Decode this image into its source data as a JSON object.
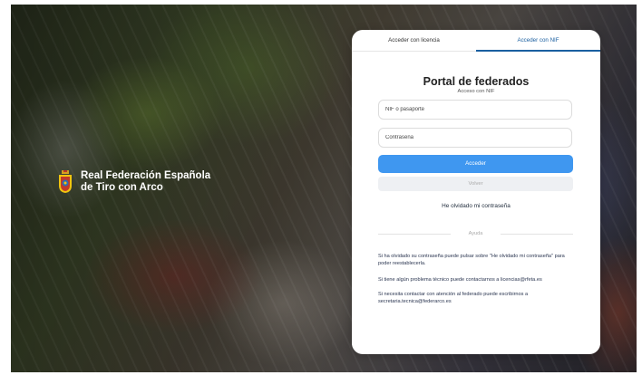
{
  "brand": {
    "name_line1": "Real Federación Española",
    "name_line2": "de Tiro con Arco"
  },
  "tabs": [
    {
      "label": "Acceder con licencia",
      "active": false
    },
    {
      "label": "Acceder con NIF",
      "active": true
    }
  ],
  "login": {
    "title": "Portal de federados",
    "subtitle": "Acceso con NIF",
    "nif_placeholder": "NIF o pasaporte",
    "password_placeholder": "Contraseña",
    "submit_label": "Acceder",
    "back_label": "Volver",
    "forgot_label": "He olvidado mi contraseña"
  },
  "help": {
    "heading": "Ayuda",
    "lines": [
      "Si ha olvidado su contraseña puede pulsar sobre \"He olvidado mi contraseña\" para poder reestablecerla.",
      "Si tiene algún problema técnico puede contactarnos a licencias@rfeta.es",
      "Si necesita contactar con atención al federado puede escribirnos a secretaria.tecnica@federarco.es"
    ]
  },
  "colors": {
    "accent": "#3f97f0",
    "tab_active": "#1a5fa0"
  }
}
